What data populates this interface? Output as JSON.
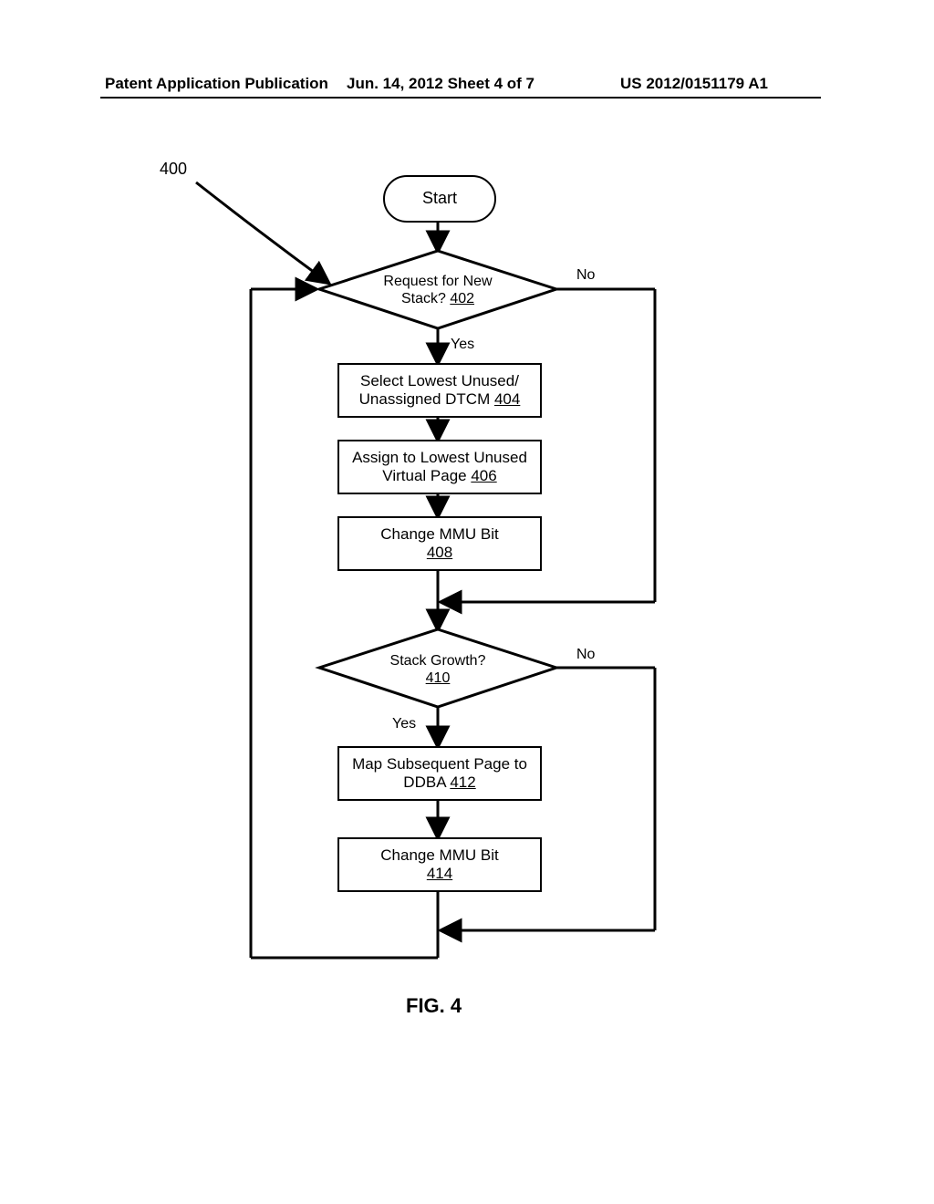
{
  "header": {
    "left": "Patent Application Publication",
    "mid": "Jun. 14, 2012  Sheet 4 of 7",
    "right": "US 2012/0151179 A1"
  },
  "diagram": {
    "ref": "400",
    "start": "Start",
    "dec1_line1": "Request for New",
    "dec1_line2a": "Stack? ",
    "dec1_ref": "402",
    "dec1_no": "No",
    "dec1_yes": "Yes",
    "box1_line1": "Select Lowest Unused/",
    "box1_line2a": "Unassigned DTCM ",
    "box1_ref": "404",
    "box2_line1": "Assign to Lowest Unused",
    "box2_line2a": "Virtual Page ",
    "box2_ref": "406",
    "box3_line1": "Change MMU Bit",
    "box3_ref": "408",
    "dec2_line1": "Stack Growth?",
    "dec2_ref": "410",
    "dec2_no": "No",
    "dec2_yes": "Yes",
    "box4_line1": "Map Subsequent Page to",
    "box4_line2a": "DDBA ",
    "box4_ref": "412",
    "box5_line1": "Change MMU Bit",
    "box5_ref": "414",
    "figure": "FIG. 4"
  }
}
